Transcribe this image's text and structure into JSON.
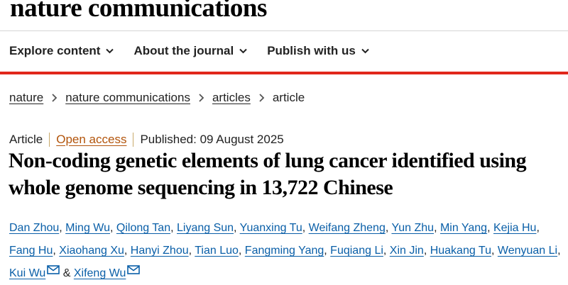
{
  "header": {
    "logo": "nature communications",
    "nav": [
      {
        "label": "Explore content",
        "icon": "chevron-down-icon"
      },
      {
        "label": "About the journal",
        "icon": "chevron-down-icon"
      },
      {
        "label": "Publish with us",
        "icon": "chevron-down-icon"
      }
    ],
    "accent_color": "#e1271b"
  },
  "breadcrumb": {
    "items": [
      "nature",
      "nature communications",
      "articles"
    ],
    "current": "article"
  },
  "article": {
    "type": "Article",
    "access": "Open access",
    "published": "Published: 09 August 2025",
    "title": "Non-coding genetic elements of lung cancer identified using whole genome sequencing in 13,722 Chinese",
    "authors": [
      "Dan Zhou",
      "Ming Wu",
      "Qilong Tan",
      "Liyang Sun",
      "Yuanxing Tu",
      "Weifang Zheng",
      "Yun Zhu",
      "Min Yang",
      "Kejia Hu",
      "Fang Hu",
      "Xiaohang Xu",
      "Hanyi Zhou",
      "Tian Luo",
      "Fangming Yang",
      "Fuqiang Li",
      "Xin Jin",
      "Huakang Tu",
      "Wenyuan Li",
      "Kui Wu",
      "Xifeng Wu"
    ],
    "connector": "&",
    "link_color": "#0a5fa8",
    "access_color": "#b2540b"
  }
}
